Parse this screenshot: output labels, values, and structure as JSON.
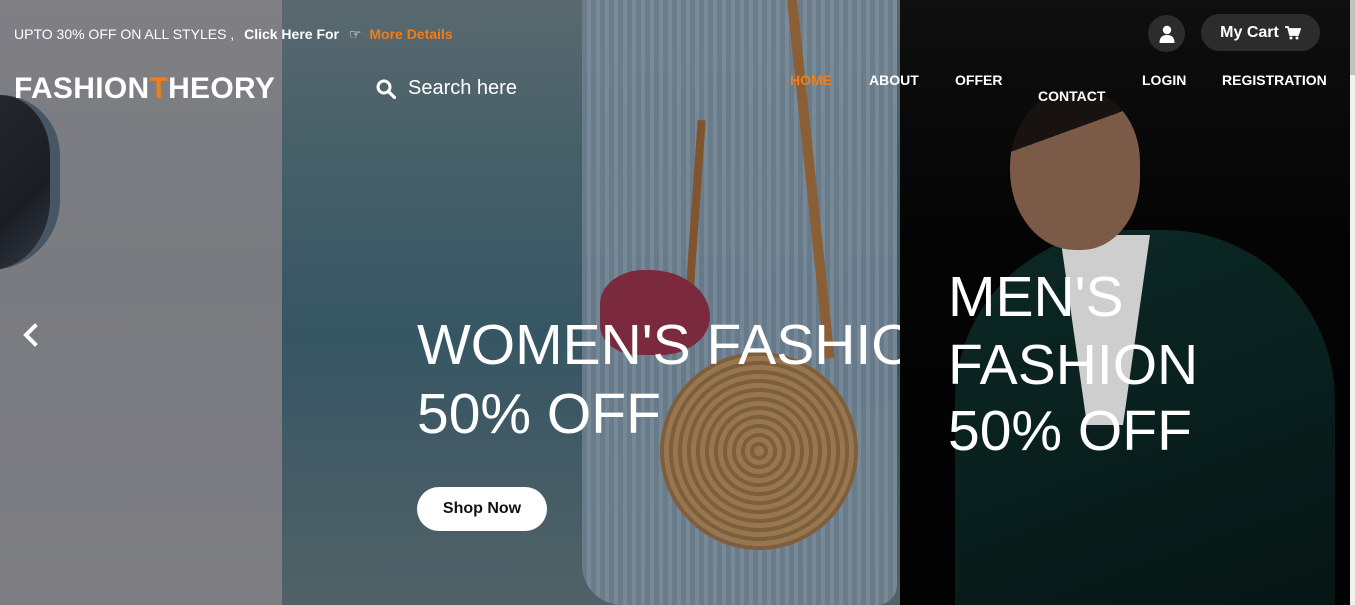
{
  "promo": {
    "text": "UPTO 30% OFF ON ALL STYLES ,",
    "bold": "Click Here For",
    "link": "More Details"
  },
  "header": {
    "logo_part1": "FASHION",
    "logo_accent": "T",
    "logo_part2": "HEORY",
    "search_text": "Search here",
    "cart_label": "My Cart"
  },
  "nav": {
    "home": "HOME",
    "about": "ABOUT",
    "offer": "OFFER",
    "contact": "CONTACT",
    "login": "LOGIN",
    "registration": "REGISTRATION"
  },
  "slides": {
    "women_line1": "WOMEN'S FASHION",
    "women_line2": "50% OFF",
    "shop_now": "Shop Now",
    "men_line1": "MEN'S",
    "men_line2": "FASHION",
    "men_line3": "50% OFF"
  },
  "colors": {
    "accent": "#f07d1a",
    "button_dark": "#2c2c2c",
    "text": "#ffffff"
  },
  "icons": [
    "hand-pointer-icon",
    "user-icon",
    "cart-icon",
    "search-icon",
    "chevron-left-icon"
  ]
}
